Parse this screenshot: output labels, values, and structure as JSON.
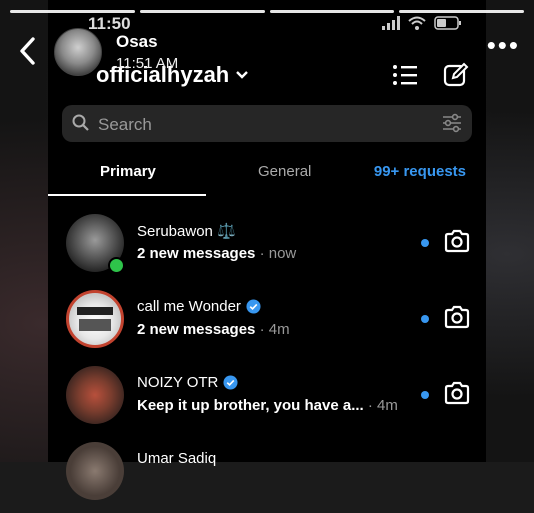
{
  "story": {
    "name": "Osas",
    "time": "11:51 AM",
    "more": "•••",
    "progress_segments": 4
  },
  "status_bar": {
    "time": "11:50"
  },
  "header": {
    "username": "officialhyzah"
  },
  "search": {
    "placeholder": "Search"
  },
  "tabs": {
    "primary": "Primary",
    "general": "General",
    "requests": "99+ requests"
  },
  "colors": {
    "accent": "#3897f0",
    "online": "#2ec34a",
    "verified": "#3897f0",
    "background": "#000000"
  },
  "chats": [
    {
      "name": "Serubawon ⚖️",
      "message": "2 new messages",
      "time": "· now",
      "online": true,
      "verified": false,
      "unread": true
    },
    {
      "name": "call me Wonder",
      "message": "2 new messages",
      "time": "· 4m",
      "online": false,
      "verified": true,
      "unread": true
    },
    {
      "name": "NOIZY OTR",
      "message": "Keep it up brother, you have a...",
      "time": "· 4m",
      "online": false,
      "verified": true,
      "unread": true
    },
    {
      "name": "Umar Sadiq",
      "message": "",
      "time": "",
      "online": false,
      "verified": false,
      "unread": false
    }
  ]
}
